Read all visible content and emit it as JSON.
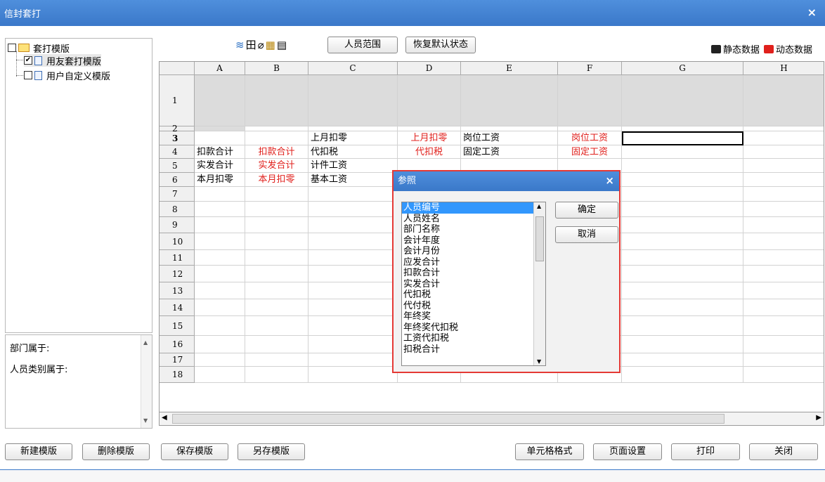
{
  "window": {
    "title": "信封套打",
    "close": "×"
  },
  "tree": {
    "root": "套打模版",
    "items": [
      {
        "label": "用友套打模版",
        "checked": true
      },
      {
        "label": "用户自定义模版",
        "checked": false
      }
    ]
  },
  "info": {
    "dept": "部门属于:",
    "person_type": "人员类别属于:"
  },
  "toolbar": {
    "icons": [
      "≋",
      "田",
      "⌀",
      "▦",
      "▤"
    ],
    "person_range": "人员范围",
    "restore_default": "恢复默认状态"
  },
  "legend": {
    "static": "静态数据",
    "dynamic": "动态数据",
    "static_color": "#222222",
    "dynamic_color": "#e0201c"
  },
  "grid": {
    "columns": [
      "A",
      "B",
      "C",
      "D",
      "E",
      "F",
      "G",
      "H"
    ],
    "rows": [
      "1",
      "2",
      "3",
      "4",
      "5",
      "6",
      "7",
      "8",
      "9",
      "10",
      "11",
      "12",
      "13",
      "14",
      "15",
      "16",
      "17",
      "18"
    ],
    "cells": {
      "C3": "上月扣零",
      "D3": "上月扣零",
      "E3": "岗位工资",
      "F3": "岗位工资",
      "A4": "扣款合计",
      "B4": "扣款合计",
      "C4": "代扣税",
      "D4": "代扣税",
      "E4": "固定工资",
      "F4": "固定工资",
      "A5": "实发合计",
      "B5": "实发合计",
      "C5": "计件工资",
      "A6": "本月扣零",
      "B6": "本月扣零",
      "C6": "基本工资"
    }
  },
  "dialog": {
    "title": "参照",
    "ok": "确定",
    "cancel": "取消",
    "items": [
      "人员编号",
      "人员姓名",
      "部门名称",
      "会计年度",
      "会计月份",
      "应发合计",
      "扣款合计",
      "实发合计",
      "代扣税",
      "代付税",
      "年终奖",
      "年终奖代扣税",
      "工资代扣税",
      "扣税合计"
    ]
  },
  "buttons": {
    "new_template": "新建模版",
    "delete_template": "删除模版",
    "save_template": "保存模版",
    "save_as_template": "另存模版",
    "cell_format": "单元格格式",
    "page_setup": "页面设置",
    "print": "打印",
    "close": "关闭"
  }
}
